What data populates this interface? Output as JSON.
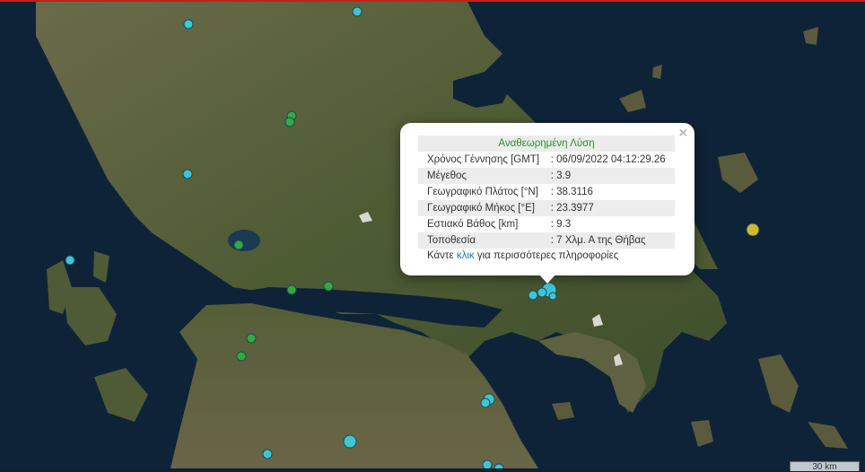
{
  "popup": {
    "title": "Αναθεωρημένη Λύση",
    "close": "×",
    "rows": [
      {
        "label": "Χρόνος Γέννησης [GMT]",
        "value": ": 06/09/2022 04:12:29.26"
      },
      {
        "label": "Μέγεθος",
        "value": ": 3.9"
      },
      {
        "label": "Γεωγραφικό Πλάτος [°N]",
        "value": ": 38.3116"
      },
      {
        "label": "Γεωγραφικό Μήκος [°E]",
        "value": ": 23.3977"
      },
      {
        "label": "Εστιακό Βάθος [km]",
        "value": ": 9.3"
      },
      {
        "label": "Τοποθεσία",
        "value": ": 7 Χλμ. Α της Θήβας"
      }
    ],
    "more_prefix": "Κάντε",
    "more_link": "κλικ",
    "more_suffix": "για περισσότερες πληροφορίες"
  },
  "scale_label": "30 km",
  "colors": {
    "sea": "#0e2236",
    "land": "#4a5a30",
    "cyan_marker": "#3fc6d6",
    "green_marker": "#36a845",
    "yellow_marker": "#d4b730"
  }
}
